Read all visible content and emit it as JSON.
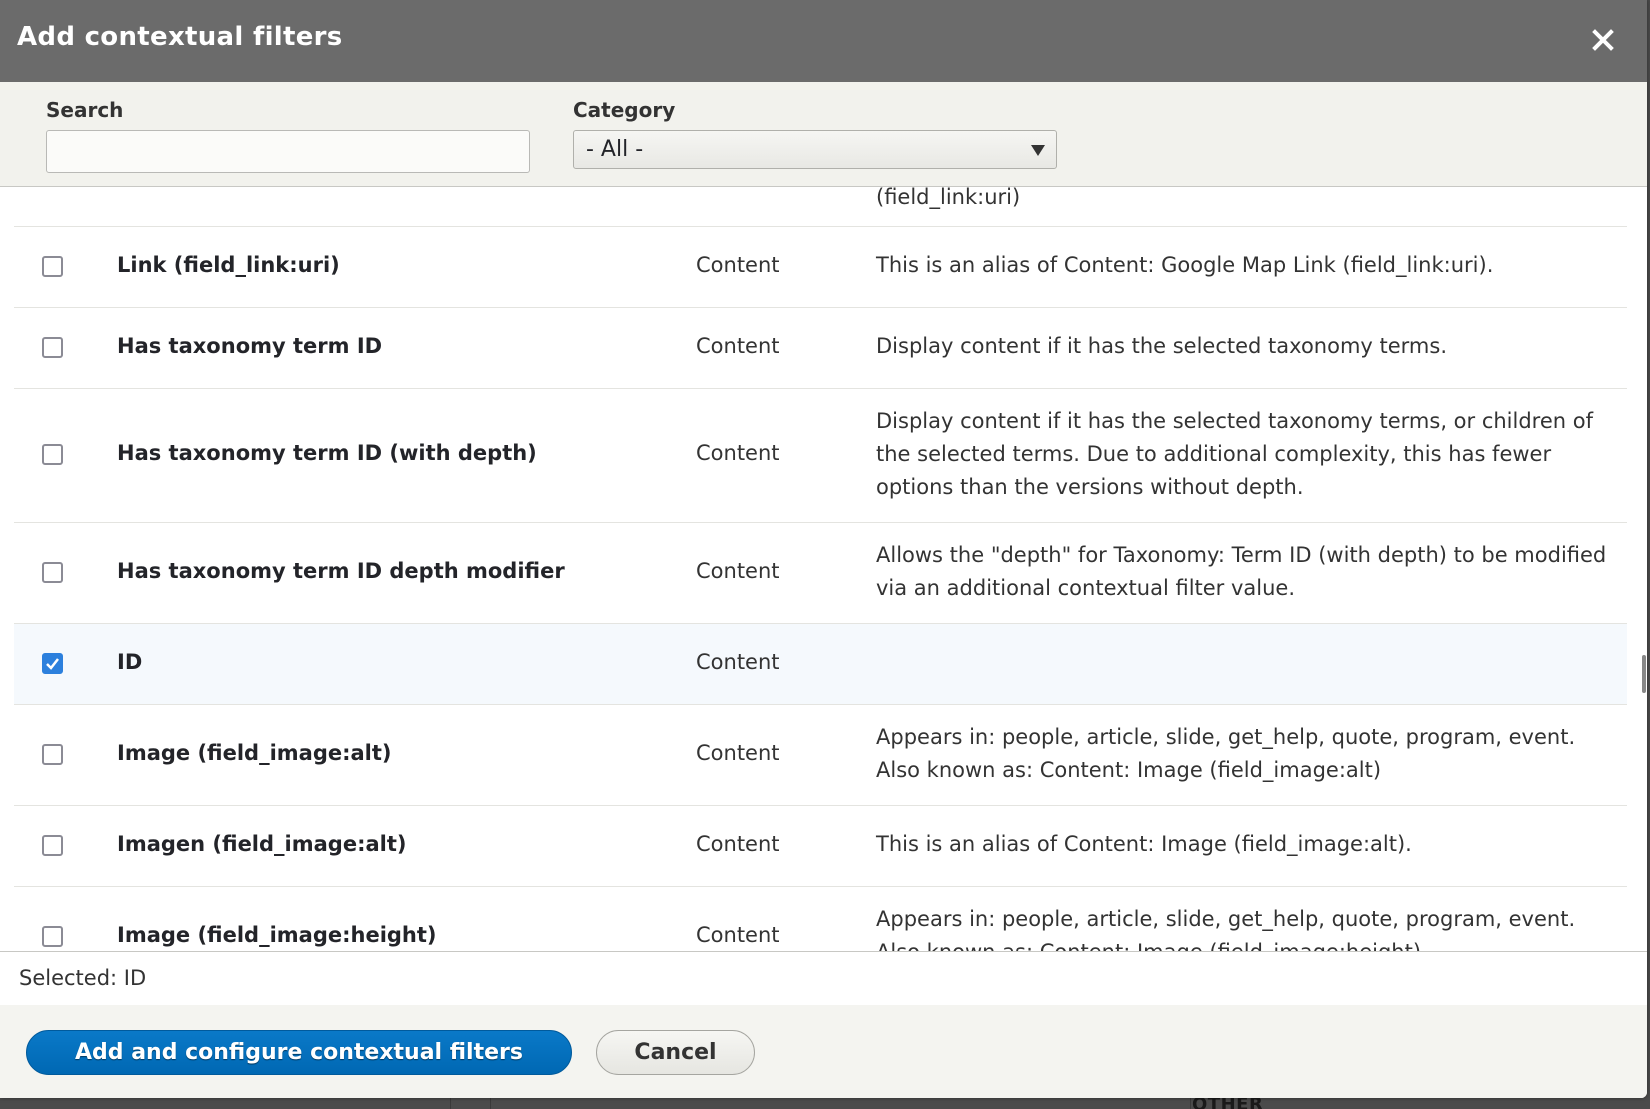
{
  "dialog": {
    "title": "Add contextual filters",
    "close_icon": "close-icon"
  },
  "filters": {
    "search_label": "Search",
    "search_value": "",
    "search_placeholder": "",
    "category_label": "Category",
    "category_selected": "- All -"
  },
  "list": {
    "partial_top_desc": "(field_link:uri)",
    "rows": [
      {
        "name": "Link (field_link:uri)",
        "category": "Content",
        "description": "This is an alias of Content: Google Map Link (field_link:uri).",
        "checked": false
      },
      {
        "name": "Has taxonomy term ID",
        "category": "Content",
        "description": "Display content if it has the selected taxonomy terms.",
        "checked": false
      },
      {
        "name": "Has taxonomy term ID (with depth)",
        "category": "Content",
        "description": "Display content if it has the selected taxonomy terms, or children of the selected terms. Due to additional complexity, this has fewer options than the versions without depth.",
        "checked": false
      },
      {
        "name": "Has taxonomy term ID depth modifier",
        "category": "Content",
        "description": "Allows the \"depth\" for Taxonomy: Term ID (with depth) to be modified via an additional contextual filter value.",
        "checked": false
      },
      {
        "name": "ID",
        "category": "Content",
        "description": "",
        "checked": true
      },
      {
        "name": "Image (field_image:alt)",
        "category": "Content",
        "description": "Appears in: people, article, slide, get_help, quote, program, event. Also known as: Content: Image (field_image:alt)",
        "checked": false
      },
      {
        "name": "Imagen (field_image:alt)",
        "category": "Content",
        "description": "This is an alias of Content: Image (field_image:alt).",
        "checked": false
      },
      {
        "name": "Image (field_image:height)",
        "category": "Content",
        "description": "Appears in: people, article, slide, get_help, quote, program, event. Also known as: Content: Image (field_image:height)",
        "checked": false
      }
    ]
  },
  "selection": {
    "text": "Selected: ID"
  },
  "buttons": {
    "primary": "Add and configure contextual filters",
    "cancel": "Cancel"
  },
  "background": {
    "partial_heading": "OTHER"
  },
  "colors": {
    "titlebar": "#6b6b6b",
    "primary_button": "#0071c1",
    "checkbox_checked": "#2c80dd",
    "selected_row": "#f5f9fd"
  }
}
